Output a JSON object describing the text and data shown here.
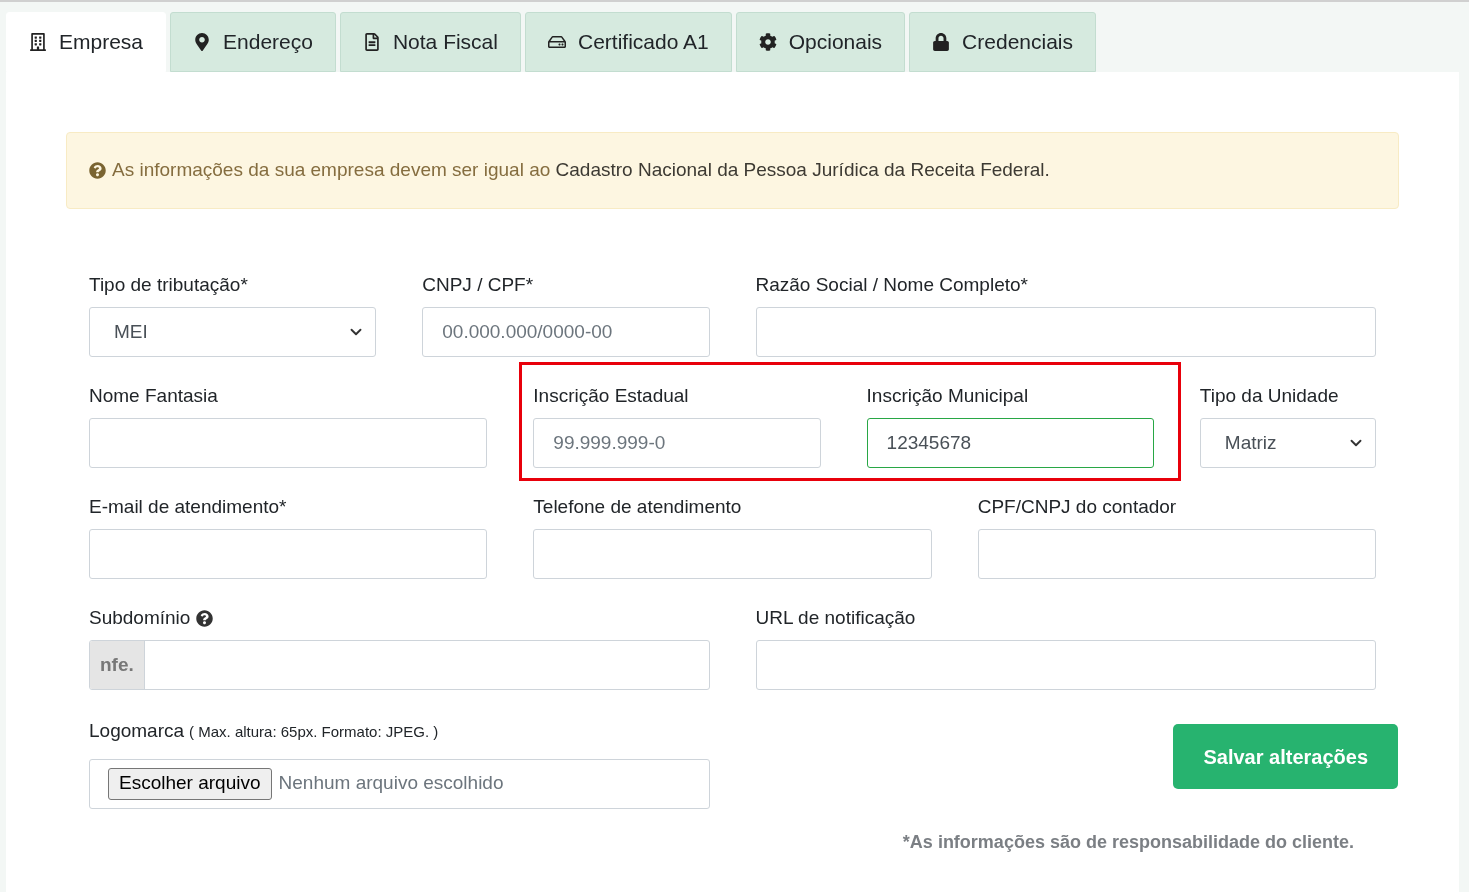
{
  "tabs": [
    {
      "label": "Empresa",
      "selected": true
    },
    {
      "label": "Endereço",
      "selected": false
    },
    {
      "label": "Nota Fiscal",
      "selected": false
    },
    {
      "label": "Certificado A1",
      "selected": false
    },
    {
      "label": "Opcionais",
      "selected": false
    },
    {
      "label": "Credenciais",
      "selected": false
    }
  ],
  "alert": {
    "message": "As informações da sua empresa devem ser igual ao",
    "emphasis": "Cadastro Nacional da Pessoa Jurídica da Receita Federal."
  },
  "rows": [
    [
      {
        "kind": "select",
        "label": "Tipo de tributação*",
        "value": "MEI"
      },
      {
        "kind": "input",
        "label": "CNPJ / CPF*",
        "placeholder": "00.000.000/0000-00"
      },
      {
        "kind": "input",
        "label": "Razão Social / Nome Completo*"
      }
    ],
    [
      {
        "kind": "input",
        "label": "Nome Fantasia"
      },
      {
        "kind": "group",
        "highlighted": true,
        "fields": [
          {
            "kind": "input",
            "label": "Inscrição Estadual",
            "placeholder": "99.999.999-0"
          },
          {
            "kind": "input",
            "label": "Inscrição Municipal",
            "value": "12345678",
            "focused": true
          }
        ]
      },
      {
        "kind": "select",
        "label": "Tipo da Unidade",
        "value": "Matriz"
      }
    ],
    [
      {
        "kind": "input",
        "label": "E-mail de atendimento*"
      },
      {
        "kind": "input",
        "label": "Telefone de atendimento"
      },
      {
        "kind": "input",
        "label": "CPF/CNPJ do contador"
      }
    ],
    [
      {
        "kind": "addon",
        "label": "Subdomínio",
        "help": true,
        "addon": "nfe."
      },
      {
        "kind": "input",
        "label": "URL de notificação"
      }
    ]
  ],
  "logo": {
    "label": "Logomarca",
    "hint": "( Max. altura: 65px. Formato: JPEG. )",
    "button": "Escolher arquivo",
    "status": "Nenhum arquivo escolhido"
  },
  "save_button": "Salvar alterações",
  "footnote": "*As informações são de responsabilidade do cliente."
}
